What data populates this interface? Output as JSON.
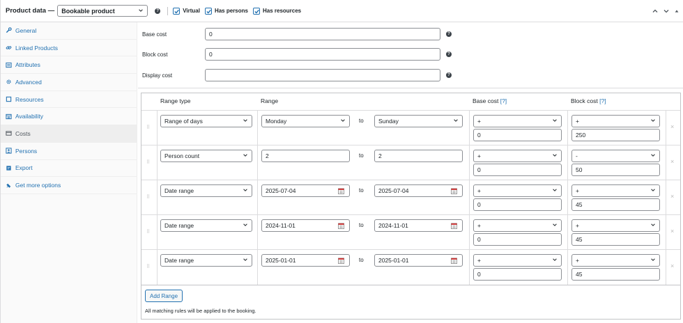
{
  "header": {
    "title": "Product data —",
    "product_type": "Bookable product",
    "options": [
      {
        "label": "Virtual",
        "checked": true
      },
      {
        "label": "Has persons",
        "checked": true
      },
      {
        "label": "Has resources",
        "checked": true
      }
    ]
  },
  "tabs": [
    {
      "label": "General",
      "icon": "wrench-icon"
    },
    {
      "label": "Linked Products",
      "icon": "link-icon"
    },
    {
      "label": "Attributes",
      "icon": "list-icon"
    },
    {
      "label": "Advanced",
      "icon": "gear-icon"
    },
    {
      "label": "Resources",
      "icon": "box-icon"
    },
    {
      "label": "Availability",
      "icon": "calendar-icon"
    },
    {
      "label": "Costs",
      "icon": "money-icon",
      "active": true
    },
    {
      "label": "Persons",
      "icon": "persons-icon"
    },
    {
      "label": "Export",
      "icon": "export-icon"
    },
    {
      "label": "Get more options",
      "icon": "plugin-icon"
    }
  ],
  "fields": [
    {
      "label": "Base cost",
      "value": "0"
    },
    {
      "label": "Block cost",
      "value": "0"
    },
    {
      "label": "Display cost",
      "value": ""
    }
  ],
  "table": {
    "headers": {
      "range_type": "Range type",
      "range": "Range",
      "base_cost": "Base cost",
      "block_cost": "Block cost",
      "help": "[?]"
    },
    "to_label": "to",
    "rows": [
      {
        "type": "Range of days",
        "from": "Monday",
        "to": "Sunday",
        "range_kind": "select",
        "base_mod": "+",
        "base_val": "0",
        "block_mod": "+",
        "block_val": "250"
      },
      {
        "type": "Person count",
        "from": "2",
        "to": "2",
        "range_kind": "text",
        "base_mod": "+",
        "base_val": "0",
        "block_mod": "-",
        "block_val": "50"
      },
      {
        "type": "Date range",
        "from": "2025-07-04",
        "to": "2025-07-04",
        "range_kind": "date",
        "base_mod": "+",
        "base_val": "0",
        "block_mod": "+",
        "block_val": "45"
      },
      {
        "type": "Date range",
        "from": "2024-11-01",
        "to": "2024-11-01",
        "range_kind": "date",
        "base_mod": "+",
        "base_val": "0",
        "block_mod": "+",
        "block_val": "45"
      },
      {
        "type": "Date range",
        "from": "2025-01-01",
        "to": "2025-01-01",
        "range_kind": "date",
        "base_mod": "+",
        "base_val": "0",
        "block_mod": "+",
        "block_val": "45"
      }
    ],
    "add_button": "Add Range",
    "note": "All matching rules will be applied to the booking."
  }
}
